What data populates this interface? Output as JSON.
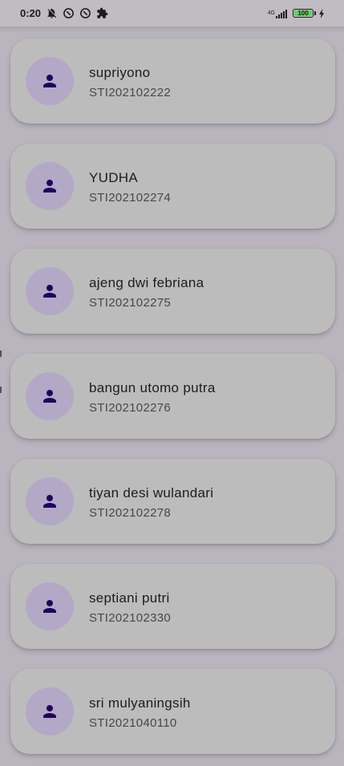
{
  "status_bar": {
    "time": "0:20",
    "icons": [
      "notifications-off-icon",
      "do-not-disturb-icon",
      "do-not-disturb-icon",
      "extension-icon"
    ],
    "network_label": "4G",
    "battery_level": "100",
    "battery_fill_percent": 100,
    "charging": true
  },
  "students": [
    {
      "name": "supriyono",
      "nim": "STI202102222"
    },
    {
      "name": "YUDHA",
      "nim": "STI202102274"
    },
    {
      "name": "ajeng dwi febriana",
      "nim": "STI202102275"
    },
    {
      "name": "bangun utomo putra",
      "nim": "STI202102276"
    },
    {
      "name": "tiyan desi wulandari",
      "nim": "STI202102278"
    },
    {
      "name": "septiani putri",
      "nim": "STI202102330"
    },
    {
      "name": "sri mulyaningsih",
      "nim": "STI2021040110"
    }
  ],
  "colors": {
    "card": "#bdbcbd",
    "avatar_bg": "#b3a9c6",
    "person_icon": "#21005d",
    "scrim": "#b9b4bd"
  }
}
